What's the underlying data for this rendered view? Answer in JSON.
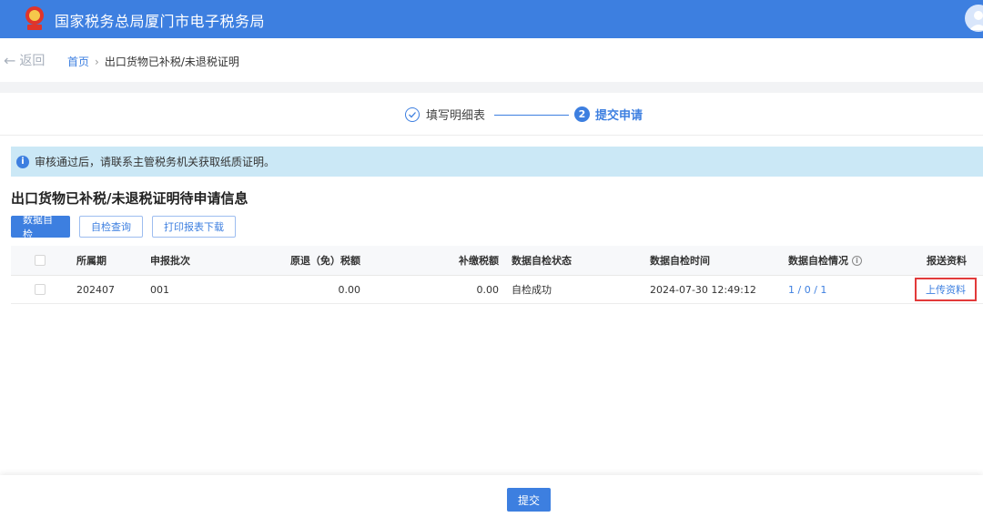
{
  "header": {
    "title": "国家税务总局厦门市电子税务局",
    "logo_icon": "tax-emblem-icon",
    "avatar_icon": "user-avatar-icon",
    "brand_color": "#3d7fe0"
  },
  "nav": {
    "back_label": "返回",
    "breadcrumb": {
      "home": "首页",
      "separator": "›",
      "current": "出口货物已补税/未退税证明"
    }
  },
  "steps": [
    {
      "label": "填写明细表",
      "status": "done",
      "icon": "check-circle-icon"
    },
    {
      "number": "2",
      "label": "提交申请",
      "status": "active"
    }
  ],
  "notice": {
    "icon": "info-icon",
    "text": "审核通过后，请联系主管税务机关获取纸质证明。",
    "color": "#cbe8f6"
  },
  "section": {
    "title": "出口货物已补税/未退税证明待申请信息"
  },
  "actions": {
    "self_check": "数据自检",
    "check_query": "自检查询",
    "print_download": "打印报表下载"
  },
  "table": {
    "columns": [
      "所属期",
      "申报批次",
      "原退（免）税额",
      "补缴税额",
      "数据自检状态",
      "数据自检时间",
      "数据自检情况",
      "报送资料"
    ],
    "rows": [
      {
        "period": "202407",
        "batch": "001",
        "original_refund": "0.00",
        "supplementary_tax": "0.00",
        "check_status": "自检成功",
        "check_time": "2024-07-30 12:49:12",
        "check_result": "1 / 0 / 1",
        "upload": "上传资料"
      }
    ],
    "highlight_color": "#e23a3a"
  },
  "footer": {
    "submit": "提交"
  }
}
